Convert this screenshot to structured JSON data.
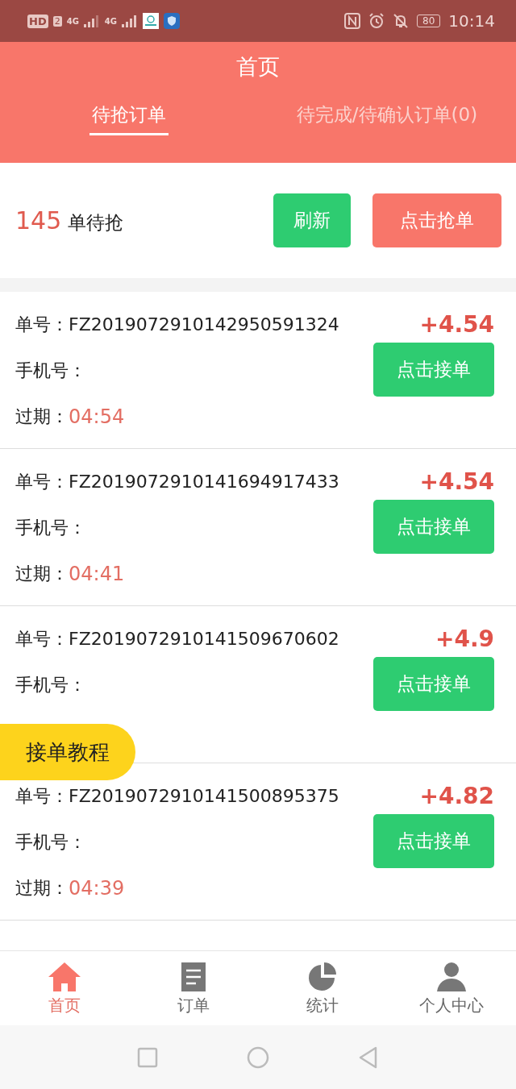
{
  "status_bar": {
    "hd": "HD",
    "sim": "2",
    "network_1": "4G",
    "network_2": "4G",
    "battery": "80",
    "time": "10:14"
  },
  "header": {
    "title": "首页"
  },
  "tabs": [
    {
      "label": "待抢订单",
      "selected": true
    },
    {
      "label": "待完成/待确认订单(0)",
      "selected": false
    }
  ],
  "summary": {
    "count": "145",
    "label": "单待抢",
    "refresh_button": "刷新",
    "grab_button": "点击抢单"
  },
  "orders": [
    {
      "number_label": "单号：",
      "number": "FZ2019072910142950591324",
      "phone_label": "手机号：",
      "expiry_label": "过期：",
      "expiry": "04:54",
      "amount": "+4.54",
      "button": "点击接单"
    },
    {
      "number_label": "单号：",
      "number": "FZ2019072910141694917433",
      "phone_label": "手机号：",
      "expiry_label": "过期：",
      "expiry": "04:41",
      "amount": "+4.54",
      "button": "点击接单"
    },
    {
      "number_label": "单号：",
      "number": "FZ2019072910141509670602",
      "phone_label": "手机号：",
      "amount": "+4.9",
      "button": "点击接单"
    },
    {
      "number_label": "单号：",
      "number": "FZ2019072910141500895375",
      "phone_label": "手机号：",
      "expiry_label": "过期：",
      "expiry": "04:39",
      "amount": "+4.82",
      "button": "点击接单"
    }
  ],
  "floating_button": "接单教程",
  "bottom_nav": [
    {
      "label": "首页",
      "selected": true
    },
    {
      "label": "订单",
      "selected": false
    },
    {
      "label": "统计",
      "selected": false
    },
    {
      "label": "个人中心",
      "selected": false
    }
  ]
}
